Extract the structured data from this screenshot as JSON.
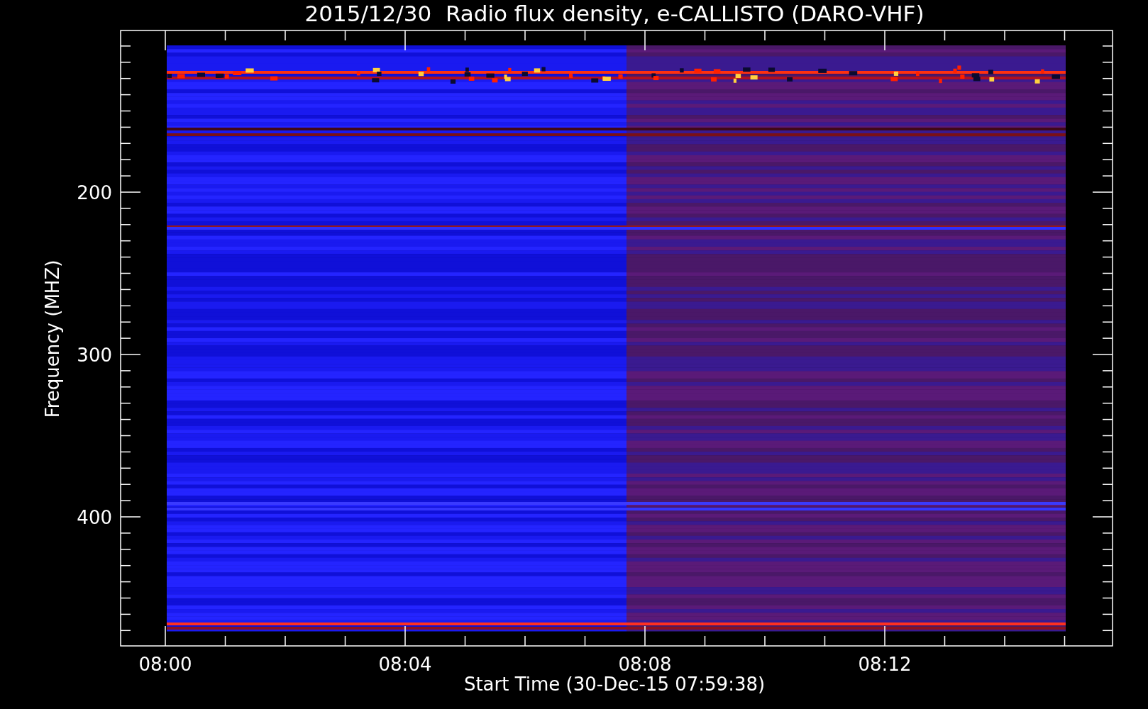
{
  "title": "2015/12/30  Radio flux density, e-CALLISTO (DARO-VHF)",
  "y_axis": {
    "label": "Frequency (MHZ)",
    "ticks": [
      "200",
      "300",
      "400"
    ]
  },
  "x_axis": {
    "label": "Start Time (30-Dec-15 07:59:38)",
    "ticks": [
      "08:00",
      "08:04",
      "08:08",
      "08:12"
    ]
  }
}
